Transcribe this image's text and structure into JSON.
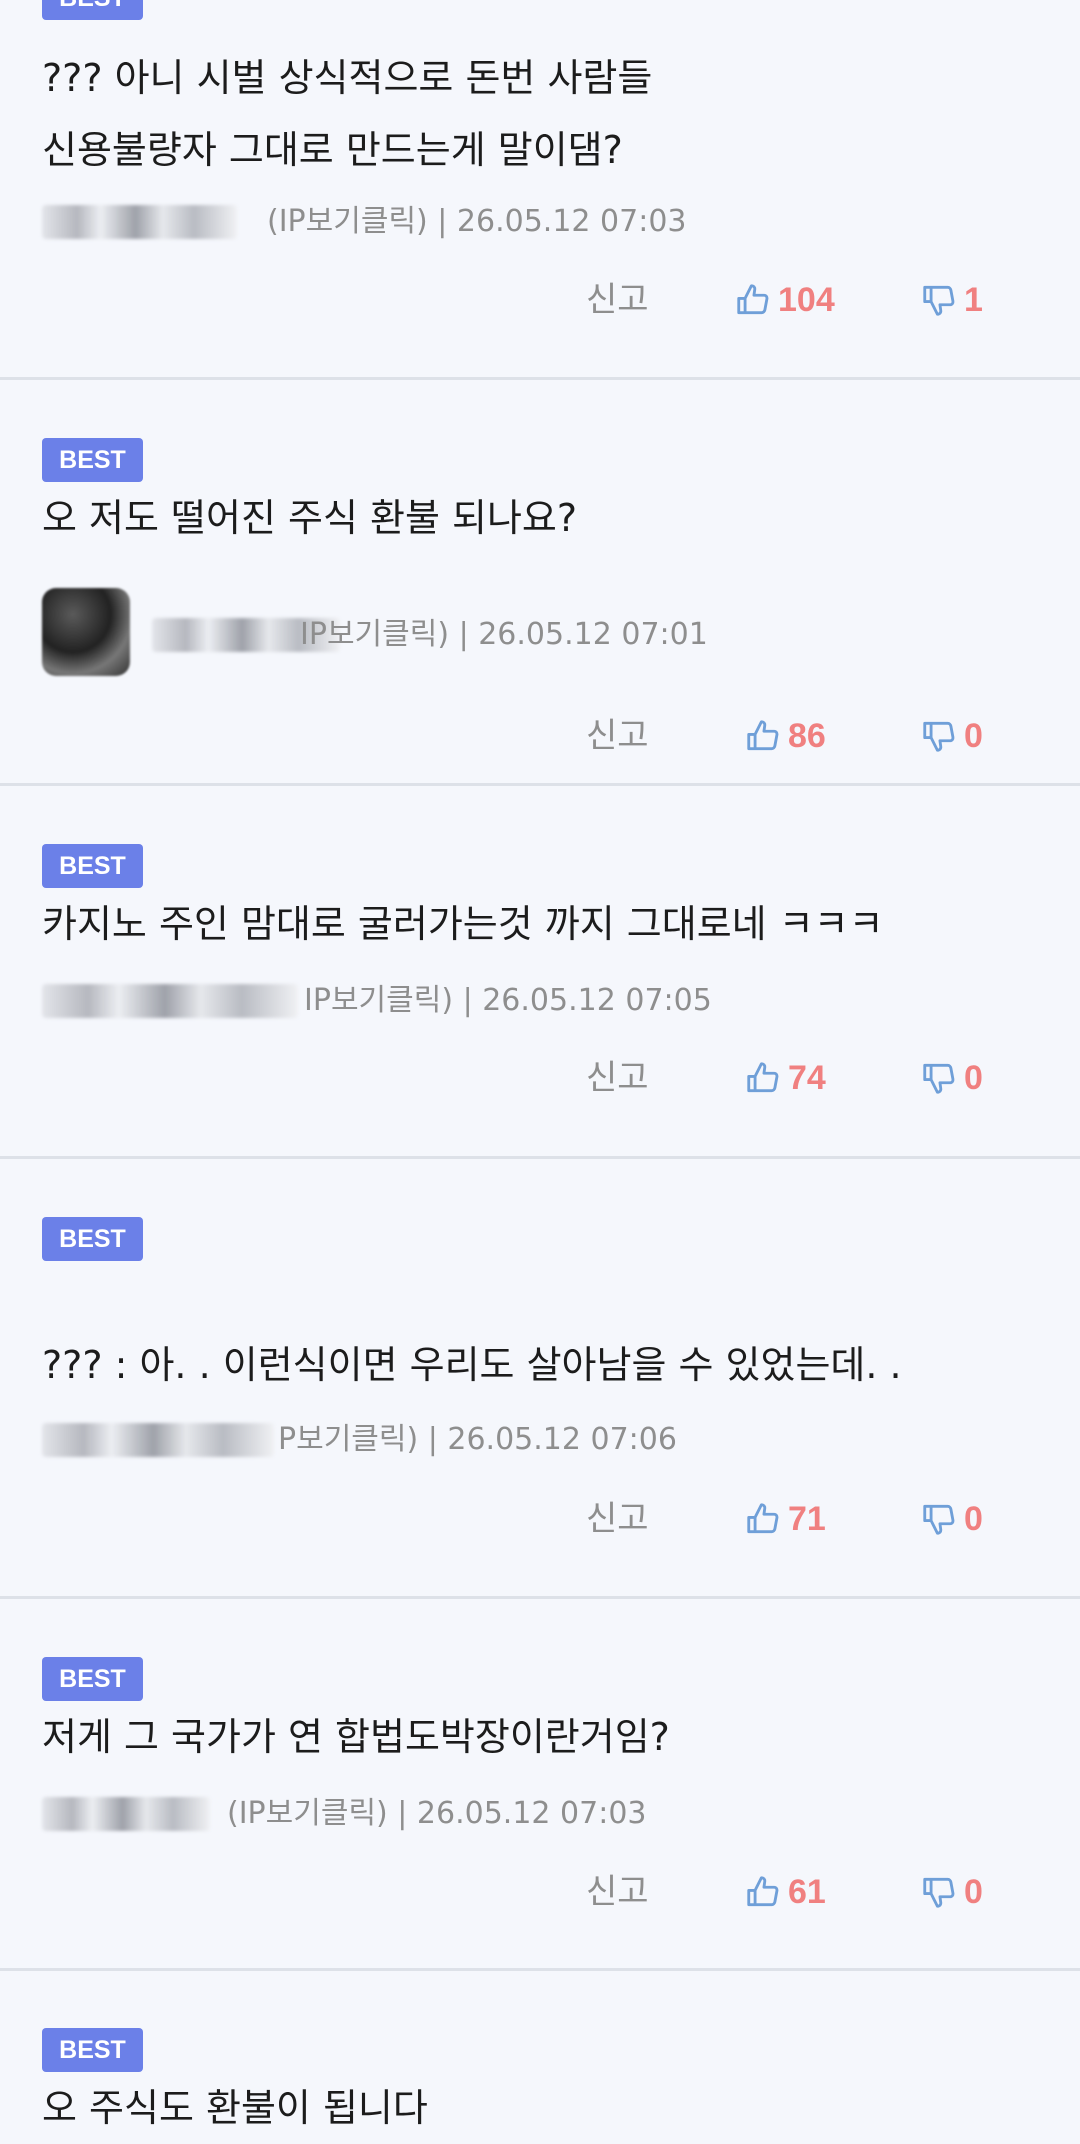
{
  "badge_label": "BEST",
  "report_label": "신고",
  "colors": {
    "badge": "#6b80e8",
    "vote_count": "#f08080",
    "icon": "#6f9fd8"
  },
  "icons": {
    "like": "thumbs-up-icon",
    "dislike": "thumbs-down-icon"
  },
  "comments": [
    {
      "text": "??? 아니 시벌 상식적으로 돈번 사람들\n신용불량자 그대로 만드는게 말이댐?",
      "meta": "(IP보기클릭) | 26.05.12 07:03",
      "likes": "104",
      "dislikes": "1"
    },
    {
      "text": "오 저도 떨어진 주식 환불 되나요?",
      "meta": "IP보기클릭) | 26.05.12 07:01",
      "likes": "86",
      "dislikes": "0"
    },
    {
      "text": "카지노 주인 맘대로 굴러가는것 까지 그대로네 ㅋㅋㅋ",
      "meta": "IP보기클릭) | 26.05.12 07:05",
      "likes": "74",
      "dislikes": "0"
    },
    {
      "text": "??? : 아. . 이런식이면 우리도 살아남을 수 있었는데. .",
      "meta": "P보기클릭) | 26.05.12 07:06",
      "likes": "71",
      "dislikes": "0"
    },
    {
      "text": "저게 그 국가가 연 합법도박장이란거임?",
      "meta": "(IP보기클릭) | 26.05.12 07:03",
      "likes": "61",
      "dislikes": "0"
    },
    {
      "text": "오 주식도 환불이 됩니다"
    }
  ]
}
